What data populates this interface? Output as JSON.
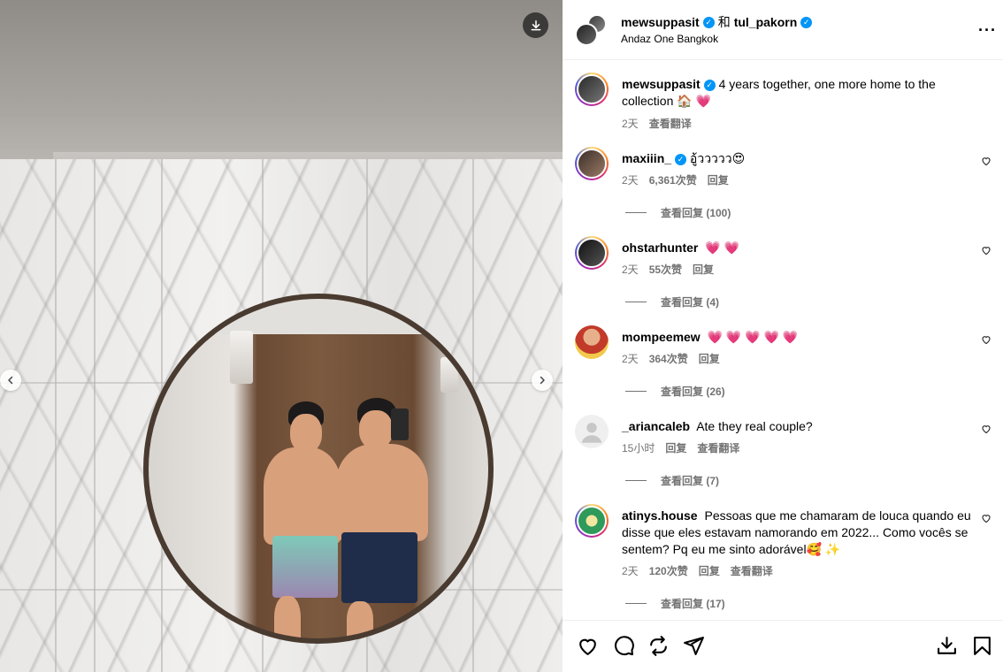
{
  "post": {
    "author": "mewsuppasit",
    "and": "和",
    "coauthor": "tul_pakorn",
    "location": "Andaz One Bangkok",
    "caption": "4 years together, one more home to the collection 🏠 💗",
    "caption_time": "2天",
    "caption_translate": "查看翻译"
  },
  "comments": [
    {
      "user": "maxiiin_",
      "verified": true,
      "text": "อู้ววววว😍",
      "time": "2天",
      "likes": "6,361次赞",
      "reply": "回复",
      "translate": "",
      "replies": "查看回复 (100)"
    },
    {
      "user": "ohstarhunter",
      "verified": false,
      "text": "💗 💗",
      "time": "2天",
      "likes": "55次赞",
      "reply": "回复",
      "translate": "",
      "replies": "查看回复 (4)"
    },
    {
      "user": "mompeemew",
      "verified": false,
      "text": "💗 💗 💗 💗 💗",
      "time": "2天",
      "likes": "364次赞",
      "reply": "回复",
      "translate": "",
      "replies": "查看回复 (26)"
    },
    {
      "user": "_ariancaleb",
      "verified": false,
      "text": "Ate they real couple?",
      "time": "15小时",
      "likes": "",
      "reply": "回复",
      "translate": "查看翻译",
      "replies": "查看回复 (7)"
    },
    {
      "user": "atinys.house",
      "verified": false,
      "text": "Pessoas que me chamaram de louca quando eu disse que eles estavam namorando em 2022... Como vocês se sentem? Pq eu me sinto adorável🥰 ✨",
      "time": "2天",
      "likes": "120次赞",
      "reply": "回复",
      "translate": "查看翻译",
      "replies": "查看回复 (17)"
    }
  ],
  "icons": {
    "download": "download-icon",
    "more": "more-options-icon",
    "like": "heart-icon",
    "comment": "comment-icon",
    "share": "share-icon",
    "save": "bookmark-icon"
  },
  "colors": {
    "verified": "#0095f6",
    "meta": "#737373"
  }
}
